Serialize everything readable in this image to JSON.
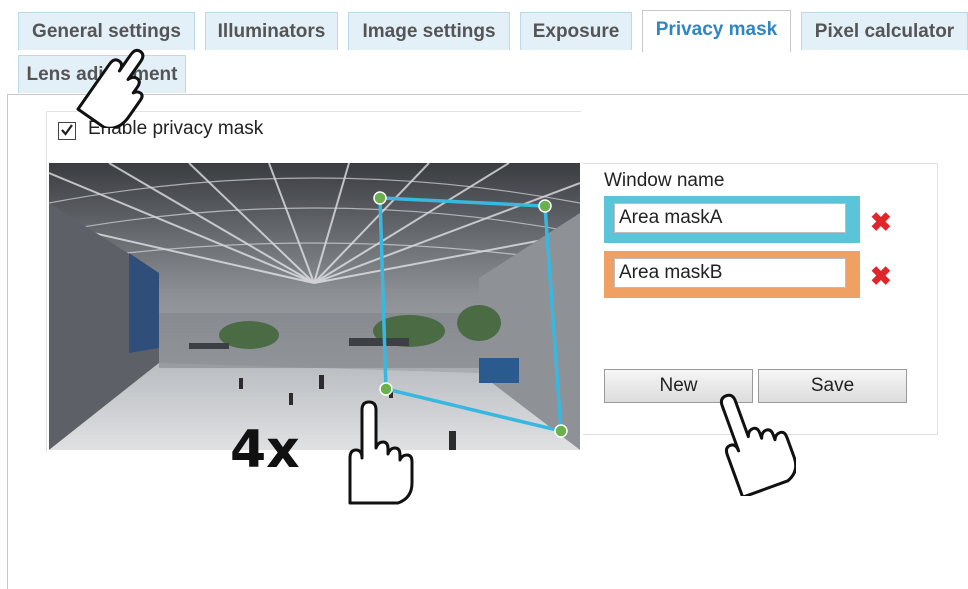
{
  "tabs": [
    {
      "label": "General settings",
      "active": false
    },
    {
      "label": "Illuminators",
      "active": false
    },
    {
      "label": "Image settings",
      "active": false
    },
    {
      "label": "Exposure",
      "active": false
    },
    {
      "label": "Privacy mask",
      "active": true
    },
    {
      "label": "Pixel calculator",
      "active": false
    },
    {
      "label": "Lens adjustment",
      "active": false
    }
  ],
  "enable_privacy_mask": {
    "label": "Enable privacy mask",
    "checked": true
  },
  "mask_panel": {
    "window_name_label": "Window name",
    "windows": [
      {
        "name": "Area maskA",
        "color": "#5bc4d9"
      },
      {
        "name": "Area maskB",
        "color": "#f1a064"
      }
    ],
    "delete_icon": "✖",
    "new_button": "New",
    "save_button": "Save"
  },
  "preview": {
    "mask_color": "#38b8e0",
    "handle_color": "#6ab04c",
    "zoom_annotation": "4x"
  },
  "colors": {
    "tab_bg": "#e3f0f8",
    "tab_active_text": "#2f86c3",
    "delete_red": "#e0262b"
  }
}
